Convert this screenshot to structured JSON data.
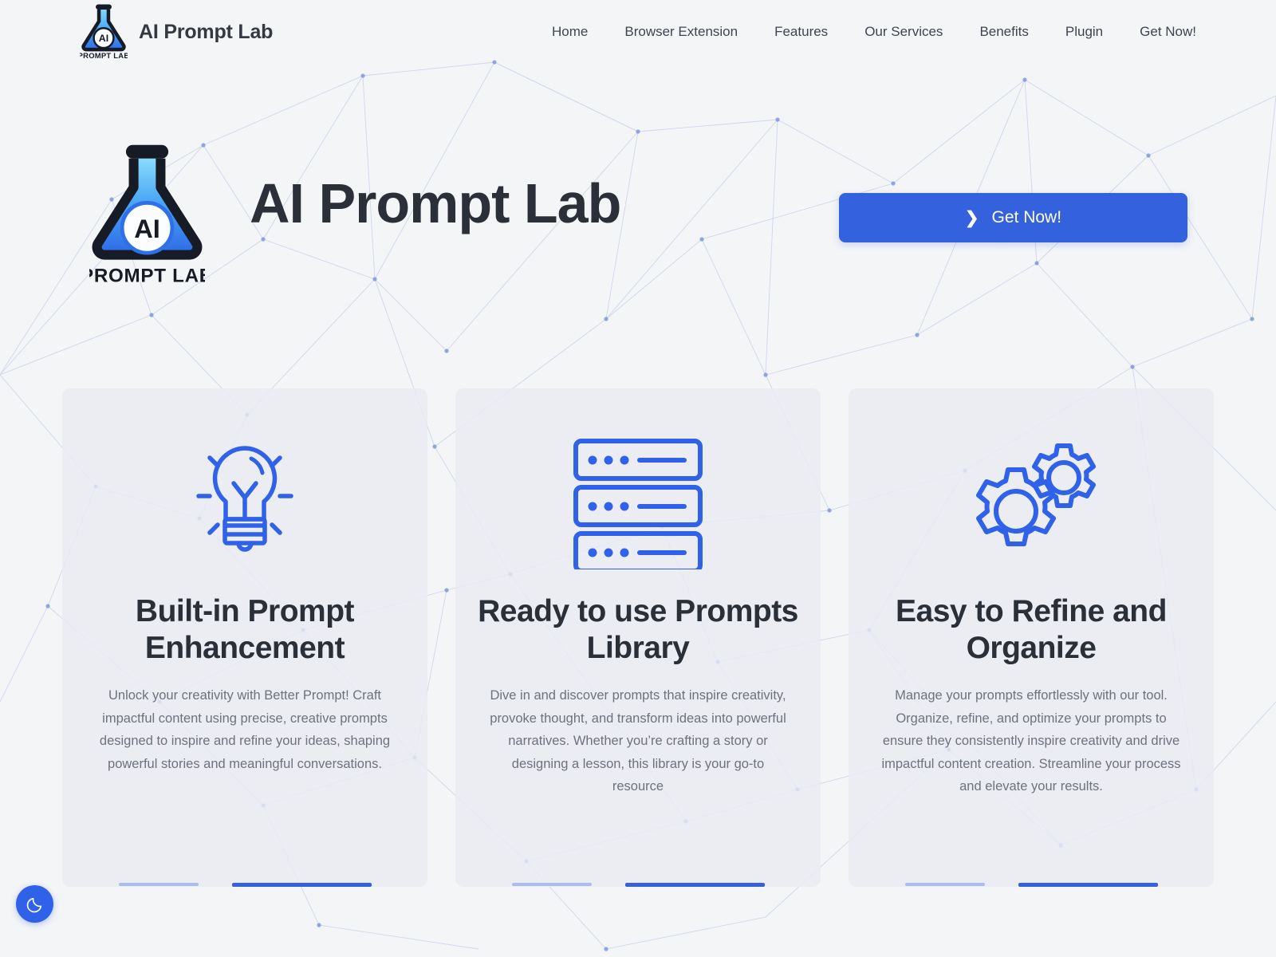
{
  "site": {
    "brand_name": "AI Prompt Lab",
    "logo_label": "PROMPT LAB",
    "logo_inner_text": "AI",
    "accent_color": "#3461dd",
    "background_color": "#f4f5f7",
    "card_background": "#e9ecf1",
    "heading_color": "#2b2f38",
    "body_text_color": "#6d727c"
  },
  "nav": {
    "items": [
      {
        "label": "Home"
      },
      {
        "label": "Browser Extension"
      },
      {
        "label": "Features"
      },
      {
        "label": "Our Services"
      },
      {
        "label": "Benefits"
      },
      {
        "label": "Plugin"
      },
      {
        "label": "Get Now!"
      }
    ]
  },
  "hero": {
    "title": "AI Prompt Lab",
    "logo_inner_text": "AI",
    "logo_label": "PROMPT LAB",
    "cta": {
      "label": "Get Now!",
      "icon": "chevron-right-icon",
      "chevron": "❯"
    }
  },
  "cards": [
    {
      "icon": "lightbulb-icon",
      "title": "Built-in Prompt Enhancement",
      "body": "Unlock your creativity with Better Prompt! Craft impactful content using precise, creative prompts designed to inspire and refine your ideas, shaping powerful stories and meaningful conversations."
    },
    {
      "icon": "server-stack-icon",
      "title": "Ready to use Prompts Library",
      "body": "Dive in and discover prompts that inspire creativity, provoke thought, and transform ideas into powerful narratives. Whether you’re crafting a story or designing a lesson, this library is your go-to resource"
    },
    {
      "icon": "gears-icon",
      "title": "Easy to Refine and Organize",
      "body": "Manage your prompts effortlessly with our tool. Organize, refine, and optimize your prompts to ensure they consistently inspire creativity and drive impactful content creation. Streamline your process and elevate your results."
    }
  ],
  "theme_toggle": {
    "icon": "moon-icon",
    "state": "dark-mode"
  }
}
